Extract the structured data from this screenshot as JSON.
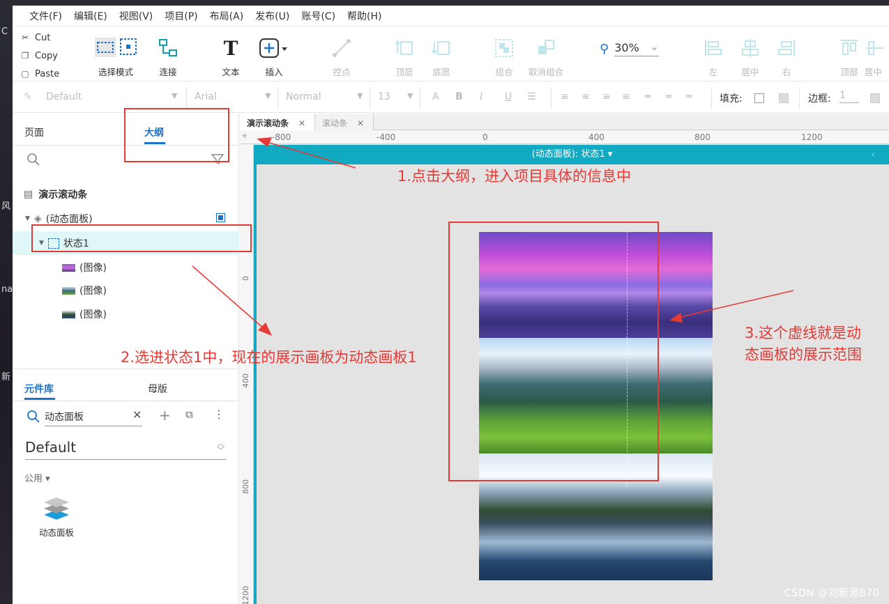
{
  "desktop": {
    "labels": [
      "C",
      "风",
      "na",
      "新"
    ]
  },
  "menu": [
    "文件(F)",
    "编辑(E)",
    "视图(V)",
    "项目(P)",
    "布局(A)",
    "发布(U)",
    "账号(C)",
    "帮助(H)"
  ],
  "clipboard": {
    "cut": "Cut",
    "copy": "Copy",
    "paste": "Paste"
  },
  "tools": {
    "select": "选择模式",
    "connect": "连接",
    "text": "文本",
    "insert": "插入",
    "point": "控点",
    "top": "顶层",
    "bottom": "底层",
    "group": "组合",
    "ungroup": "取消组合",
    "left": "左",
    "center": "居中",
    "right": "右",
    "topalign": "顶部",
    "mid": "居中"
  },
  "zoom": "30%",
  "format": {
    "style": "Default",
    "font": "Arial",
    "weight": "Normal",
    "size": "13",
    "fill_label": "填充:",
    "border_label": "边框:",
    "border_width": "1"
  },
  "left_panel": {
    "tab_pages": "页面",
    "tab_outline": "大纲",
    "tree": {
      "page": "演示滚动条",
      "panel": "(动态面板)",
      "state": "状态1",
      "img1": "(图像)",
      "img2": "(图像)",
      "img3": "(图像)"
    }
  },
  "library": {
    "tab_widgets": "元件库",
    "tab_masters": "母版",
    "search_value": "动态面板",
    "selected_lib": "Default",
    "group": "公用 ▾",
    "item": "动态面板"
  },
  "canvas": {
    "tabs": [
      "演示滚动条",
      "滚动条"
    ],
    "ruler_top": [
      "-800",
      "-400",
      "0",
      "400",
      "800",
      "1200"
    ],
    "ruler_left": [
      "0",
      "400",
      "800",
      "1200"
    ],
    "panel_header": "(动态面板): 状态1 ▾"
  },
  "annotations": {
    "note1": "1.点击大纲，进入项目具体的信息中",
    "note2": "2.选进状态1中，现在的展示画板为动态画板1",
    "note3a": "3.这个虚线就是动",
    "note3b": "态画板的展示范围"
  },
  "watermark": "CSDN @刘新源870",
  "colors": {
    "accent": "#1a73c8",
    "panel_teal": "#12a9c2",
    "annotation_red": "#e53935"
  }
}
